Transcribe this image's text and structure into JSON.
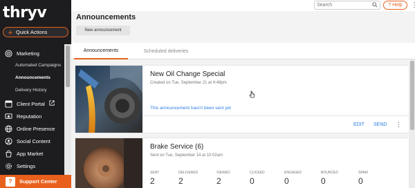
{
  "brand": {
    "logo": "thryv",
    "accent": "#e8601c",
    "link_color": "#2b7de1"
  },
  "sidebar": {
    "quick_actions": "Quick Actions",
    "items": [
      {
        "label": "Marketing",
        "icon": "target-icon"
      },
      {
        "label": "Client Portal",
        "icon": "portal-icon"
      },
      {
        "label": "Reputation",
        "icon": "reputation-icon"
      },
      {
        "label": "Online Presence",
        "icon": "globe-icon"
      },
      {
        "label": "Social Content",
        "icon": "social-icon"
      },
      {
        "label": "App Market",
        "icon": "app-market-icon"
      },
      {
        "label": "Settings",
        "icon": "gear-icon"
      }
    ],
    "sub_items": [
      "Automated Campaigns",
      "Announcements",
      "Delivery History"
    ],
    "active_sub": "Announcements",
    "support": "Support Center"
  },
  "topbar": {
    "search_placeholder": "Search",
    "help": "Help"
  },
  "page": {
    "title": "Announcements",
    "new_button": "New announcement",
    "tabs": [
      "Announcements",
      "Scheduled deliveries"
    ]
  },
  "cards": [
    {
      "title": "New Oil Change Special",
      "subtitle": "Created on Tue, September 21 at 4:48pm",
      "note": "This announcement hasn't been sent yet",
      "actions": [
        "EDIT",
        "SEND"
      ]
    },
    {
      "title": "Brake Service (6)",
      "subtitle": "Sent on Tue, September 14 at 10:02am",
      "stats": [
        {
          "label": "SENT",
          "value": "2"
        },
        {
          "label": "DELIVERED",
          "value": "2"
        },
        {
          "label": "VIEWED",
          "value": "2"
        },
        {
          "label": "CLICKED",
          "value": "0"
        },
        {
          "label": "ENGAGED",
          "value": "0"
        },
        {
          "label": "BOUNCED",
          "value": "0"
        },
        {
          "label": "SPAM",
          "value": "0"
        }
      ]
    }
  ]
}
